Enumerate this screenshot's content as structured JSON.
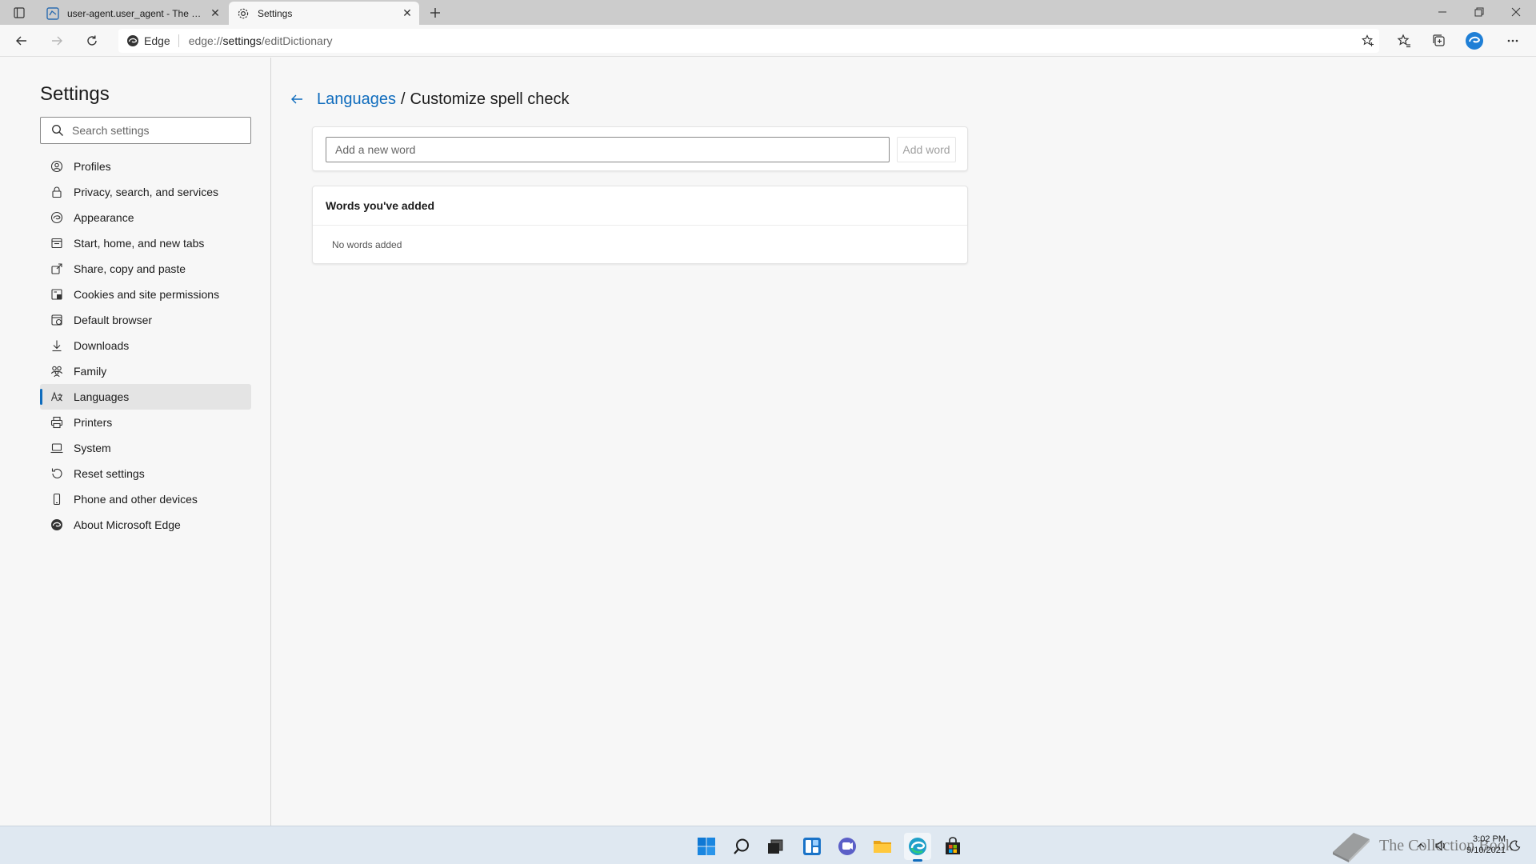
{
  "tabs": [
    {
      "title": "user-agent.user_agent - The Coll",
      "active": false
    },
    {
      "title": "Settings",
      "active": true
    }
  ],
  "address_bar": {
    "brand": "Edge",
    "url_scheme": "edge://",
    "url_host": "settings",
    "url_path": "/editDictionary"
  },
  "sidebar": {
    "title": "Settings",
    "search_placeholder": "Search settings",
    "items": [
      {
        "label": "Profiles",
        "icon": "profile-icon"
      },
      {
        "label": "Privacy, search, and services",
        "icon": "lock-icon"
      },
      {
        "label": "Appearance",
        "icon": "appearance-icon"
      },
      {
        "label": "Start, home, and new tabs",
        "icon": "home-tabs-icon"
      },
      {
        "label": "Share, copy and paste",
        "icon": "share-icon"
      },
      {
        "label": "Cookies and site permissions",
        "icon": "cookies-icon"
      },
      {
        "label": "Default browser",
        "icon": "default-browser-icon"
      },
      {
        "label": "Downloads",
        "icon": "download-icon"
      },
      {
        "label": "Family",
        "icon": "family-icon"
      },
      {
        "label": "Languages",
        "icon": "languages-icon",
        "selected": true
      },
      {
        "label": "Printers",
        "icon": "printer-icon"
      },
      {
        "label": "System",
        "icon": "laptop-icon"
      },
      {
        "label": "Reset settings",
        "icon": "reset-icon"
      },
      {
        "label": "Phone and other devices",
        "icon": "phone-icon"
      },
      {
        "label": "About Microsoft Edge",
        "icon": "edge-logo-icon"
      }
    ]
  },
  "main": {
    "breadcrumb_parent": "Languages",
    "breadcrumb_separator": "/",
    "breadcrumb_current": "Customize spell check",
    "add_word_placeholder": "Add a new word",
    "add_word_button": "Add word",
    "words_header": "Words you've added",
    "words_empty": "No words added"
  },
  "taskbar": {
    "time": "3:02 PM",
    "date": "9/10/2021",
    "watermark": "The Collection Book"
  },
  "colors": {
    "accent": "#0f6cbd",
    "tabstrip": "#cccccc",
    "page_bg": "#f7f7f7",
    "taskbar_bg": "#dfe8f1"
  }
}
